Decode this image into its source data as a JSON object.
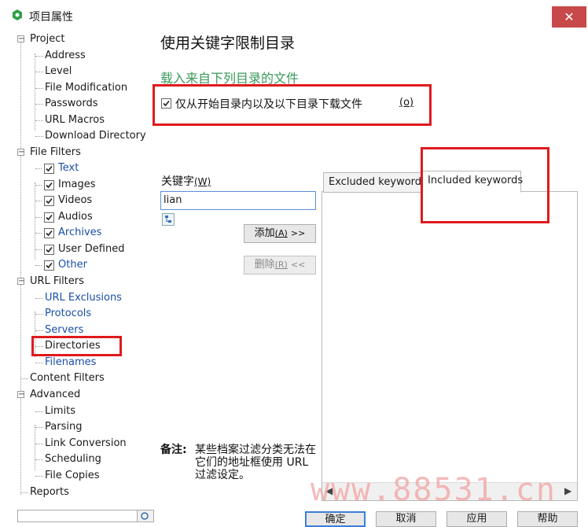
{
  "window": {
    "title": "项目属性",
    "close_label": "✕"
  },
  "tree": {
    "nodes": [
      {
        "label": "Project"
      },
      {
        "label": "Address"
      },
      {
        "label": "Level"
      },
      {
        "label": "File Modification"
      },
      {
        "label": "Passwords"
      },
      {
        "label": "URL Macros"
      },
      {
        "label": "Download Directory"
      },
      {
        "label": "File Filters"
      },
      {
        "label": "Text"
      },
      {
        "label": "Images"
      },
      {
        "label": "Videos"
      },
      {
        "label": "Audios"
      },
      {
        "label": "Archives"
      },
      {
        "label": "User Defined"
      },
      {
        "label": "Other"
      },
      {
        "label": "URL Filters"
      },
      {
        "label": "URL Exclusions"
      },
      {
        "label": "Protocols"
      },
      {
        "label": "Servers"
      },
      {
        "label": "Directories"
      },
      {
        "label": "Filenames"
      },
      {
        "label": "Content Filters"
      },
      {
        "label": "Advanced"
      },
      {
        "label": "Limits"
      },
      {
        "label": "Parsing"
      },
      {
        "label": "Link Conversion"
      },
      {
        "label": "Scheduling"
      },
      {
        "label": "File Copies"
      },
      {
        "label": "Reports"
      }
    ]
  },
  "main": {
    "page_title": "使用关键字限制目录",
    "section_title": "载入来自下列目录的文件",
    "only_start_dir": {
      "label": "仅从开始目录内以及以下目录下载文件",
      "key": "(o)",
      "checked": true
    },
    "keyword_label": "关键字",
    "keyword_key": "(W)",
    "keyword_value": "lian",
    "add_button": "添加",
    "add_key": "(A)",
    "add_arrow": ">>",
    "delete_button": "删除",
    "delete_key": "(R)",
    "delete_arrow": "<<",
    "tabs": [
      {
        "label": "Excluded keywords",
        "active": false
      },
      {
        "label": "Included keywords",
        "active": true
      }
    ],
    "note_label": "备注:",
    "note_text": "某些档案过滤分类无法在它们的地址框使用 URL 过滤设定。"
  },
  "footer": {
    "ok": "确定",
    "cancel": "取消",
    "apply": "应用",
    "help": "帮助"
  },
  "watermark": "www.88531.cn",
  "colors": {
    "highlight_box": "#e0191e",
    "section_title": "#3a9a5a",
    "link_blue": "#1a4fa8",
    "close_button": "#c7494a"
  }
}
